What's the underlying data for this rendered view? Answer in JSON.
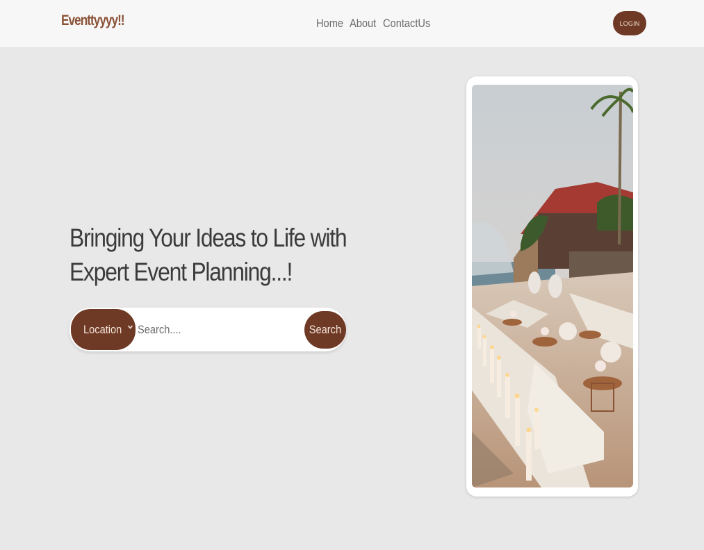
{
  "nav": {
    "brand": "Eventtyyyy!!",
    "links": [
      "Home",
      "About",
      "ContactUs"
    ],
    "login_label": "LOGIN"
  },
  "hero": {
    "title_line1": "Bringing Your Ideas to Life with",
    "title_line2": "Expert Event Planning...!"
  },
  "search": {
    "location_label": "Location",
    "placeholder": "Search....",
    "button_label": "Search"
  },
  "colors": {
    "accent": "#6f3a25",
    "brand_text": "#8a5236",
    "page_bg": "#e9e8e8",
    "nav_bg": "#f7f7f8"
  }
}
